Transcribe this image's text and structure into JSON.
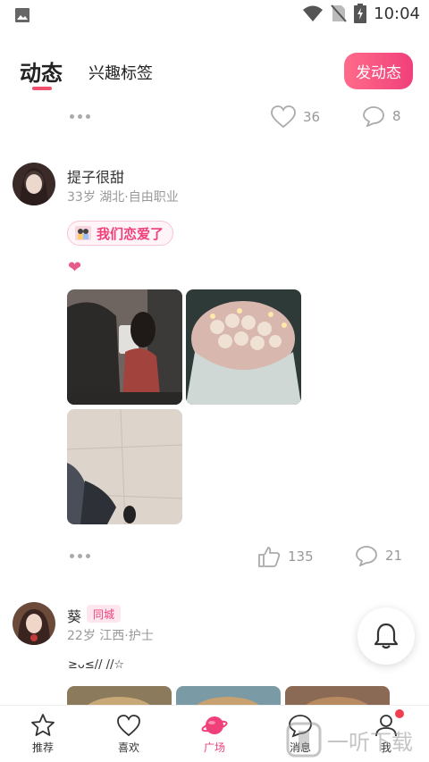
{
  "status_bar": {
    "time": "10:04"
  },
  "header": {
    "tab_active": "动态",
    "tab_other": "兴趣标签",
    "post_button": "发动态"
  },
  "top_actions": {
    "likes": "36",
    "comments": "8"
  },
  "post1": {
    "username": "提子很甜",
    "meta": "33岁 湖北·自由职业",
    "badge": "我们恋爱了",
    "content": "❤",
    "likes": "135",
    "comments": "21"
  },
  "post2": {
    "username": "葵",
    "city_badge": "同城",
    "meta": "22岁 江西·护士",
    "content": "≥ᴗ≤// //☆"
  },
  "bottom_nav": {
    "items": [
      {
        "label": "推荐",
        "icon": "star-icon"
      },
      {
        "label": "喜欢",
        "icon": "heart-icon"
      },
      {
        "label": "广场",
        "icon": "planet-icon"
      },
      {
        "label": "消息",
        "icon": "chat-icon"
      },
      {
        "label": "我",
        "icon": "person-icon"
      }
    ]
  },
  "watermark": "一听下载",
  "colors": {
    "accent": "#f0407a",
    "muted": "#999999"
  }
}
